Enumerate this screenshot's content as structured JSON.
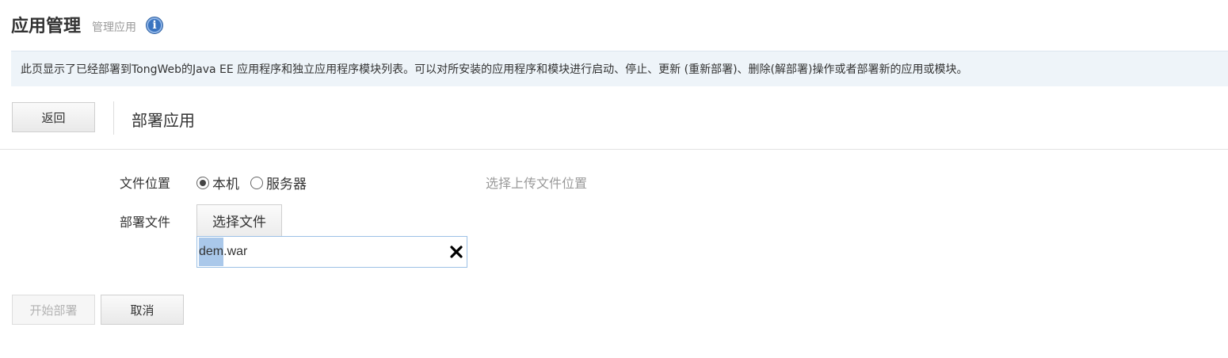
{
  "header": {
    "title": "应用管理",
    "subtitle": "管理应用",
    "info_icon_glyph": "i"
  },
  "banner": {
    "text": "此页显示了已经部署到TongWeb的Java EE 应用程序和独立应用程序模块列表。可以对所安装的应用程序和模块进行启动、停止、更新 (重新部署)、删除(解部署)操作或者部署新的应用或模块。"
  },
  "toolbar": {
    "back_label": "返回",
    "section_title": "部署应用"
  },
  "form": {
    "location_label": "文件位置",
    "location_options": [
      {
        "label": "本机",
        "selected": true
      },
      {
        "label": "服务器",
        "selected": false
      }
    ],
    "location_hint": "选择上传文件位置",
    "file_label": "部署文件",
    "choose_file_label": "选择文件",
    "file_name_selected": "dem",
    "file_name_rest": ".war"
  },
  "actions": {
    "deploy_label": "开始部署",
    "cancel_label": "取消"
  },
  "colors": {
    "banner_bg": "#eef4f9",
    "info_icon": "#3a74c0",
    "selection": "#aac8ea"
  }
}
